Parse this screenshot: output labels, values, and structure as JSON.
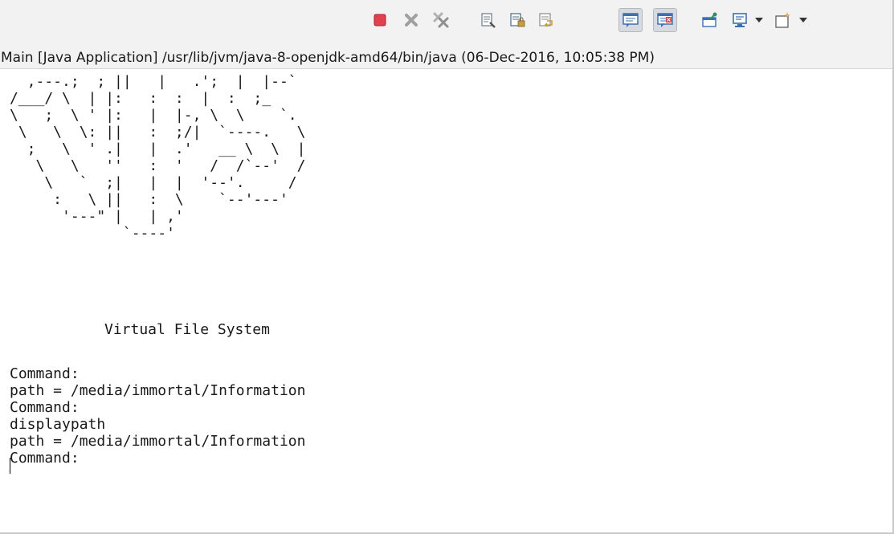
{
  "toolbar": {
    "buttons": [
      {
        "name": "terminate-icon",
        "color": "#e04050"
      },
      {
        "name": "remove-launch-icon",
        "color": "#9a9a9a"
      },
      {
        "name": "remove-all-terminated-icon",
        "color": "#9a9a9a"
      },
      {
        "name": "clear-console-icon",
        "color": "#6a7a8a"
      },
      {
        "name": "scroll-lock-icon",
        "color": "#4a6a8a"
      },
      {
        "name": "word-wrap-icon",
        "color": "#c0a040"
      },
      {
        "name": "show-on-stdout-icon",
        "color": "#3f6fb0"
      },
      {
        "name": "show-on-stderr-icon",
        "color": "#d04040"
      },
      {
        "name": "pin-console-icon",
        "color": "#2f8f5f"
      },
      {
        "name": "display-console-icon",
        "color": "#3f6fb0"
      },
      {
        "name": "open-console-icon",
        "color": "#e0b040"
      }
    ]
  },
  "console": {
    "title": "Main [Java Application] /usr/lib/jvm/java-8-openjdk-amd64/bin/java (06-Dec-2016, 10:05:38 PM)",
    "ascii_art": "  ,---.;  ; ||   |   .';  |  |--`\n/___/ \\  | |:   :  :  |  :  ;_\n\\   ;  \\ ' |:   |  |-, \\  \\    `.\n \\   \\  \\: ||   :  ;/|  `----.   \\\n  ;   \\  ' .|   |  .'   __ \\  \\  |\n   \\   \\   ''   :  '   /  /`--'  /\n    \\   `  ;|   |  |  '--'.     /\n     :   \\ ||   :  \\    `--'---'\n      '---\" |   | ,'\n             `----'",
    "banner": "Virtual File System",
    "lines": [
      "Command:",
      "path = /media/immortal/Information",
      "Command:",
      "displaypath",
      "path = /media/immortal/Information",
      "Command:"
    ]
  }
}
